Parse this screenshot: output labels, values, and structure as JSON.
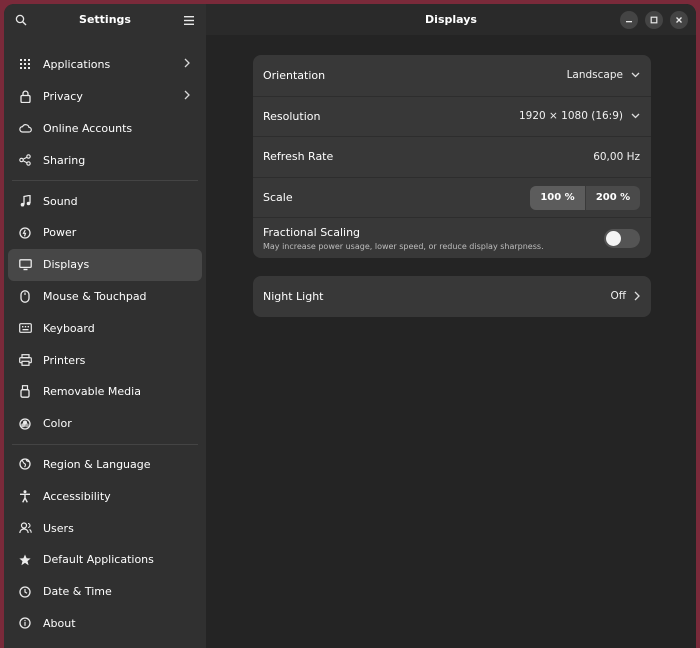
{
  "sidebar": {
    "title": "Settings",
    "groups": [
      [
        {
          "label": "Applications",
          "icon": "grid-icon",
          "chevron": true
        },
        {
          "label": "Privacy",
          "icon": "lock-icon",
          "chevron": true
        },
        {
          "label": "Online Accounts",
          "icon": "cloud-icon"
        },
        {
          "label": "Sharing",
          "icon": "share-icon"
        }
      ],
      [
        {
          "label": "Sound",
          "icon": "music-note-icon"
        },
        {
          "label": "Power",
          "icon": "power-icon"
        },
        {
          "label": "Displays",
          "icon": "monitor-icon",
          "active": true
        },
        {
          "label": "Mouse & Touchpad",
          "icon": "mouse-icon"
        },
        {
          "label": "Keyboard",
          "icon": "keyboard-icon"
        },
        {
          "label": "Printers",
          "icon": "printer-icon"
        },
        {
          "label": "Removable Media",
          "icon": "usb-icon"
        },
        {
          "label": "Color",
          "icon": "color-icon"
        }
      ],
      [
        {
          "label": "Region & Language",
          "icon": "globe-icon"
        },
        {
          "label": "Accessibility",
          "icon": "accessibility-icon"
        },
        {
          "label": "Users",
          "icon": "users-icon"
        },
        {
          "label": "Default Applications",
          "icon": "star-icon"
        },
        {
          "label": "Date & Time",
          "icon": "clock-icon"
        },
        {
          "label": "About",
          "icon": "info-icon"
        }
      ]
    ]
  },
  "main": {
    "title": "Displays",
    "orientation": {
      "label": "Orientation",
      "value": "Landscape"
    },
    "resolution": {
      "label": "Resolution",
      "value": "1920 × 1080 (16:9)"
    },
    "refresh_rate": {
      "label": "Refresh Rate",
      "value": "60,00 Hz"
    },
    "scale": {
      "label": "Scale",
      "options": [
        "100 %",
        "200 %"
      ],
      "selected": "100 %"
    },
    "fractional_scaling": {
      "label": "Fractional Scaling",
      "description": "May increase power usage, lower speed, or reduce display sharpness.",
      "enabled": false
    },
    "night_light": {
      "label": "Night Light",
      "value": "Off"
    }
  },
  "colors": {
    "window_bg": "#242424",
    "sidebar_bg": "#303030",
    "card_bg": "#383838",
    "active_item": "#474747"
  }
}
